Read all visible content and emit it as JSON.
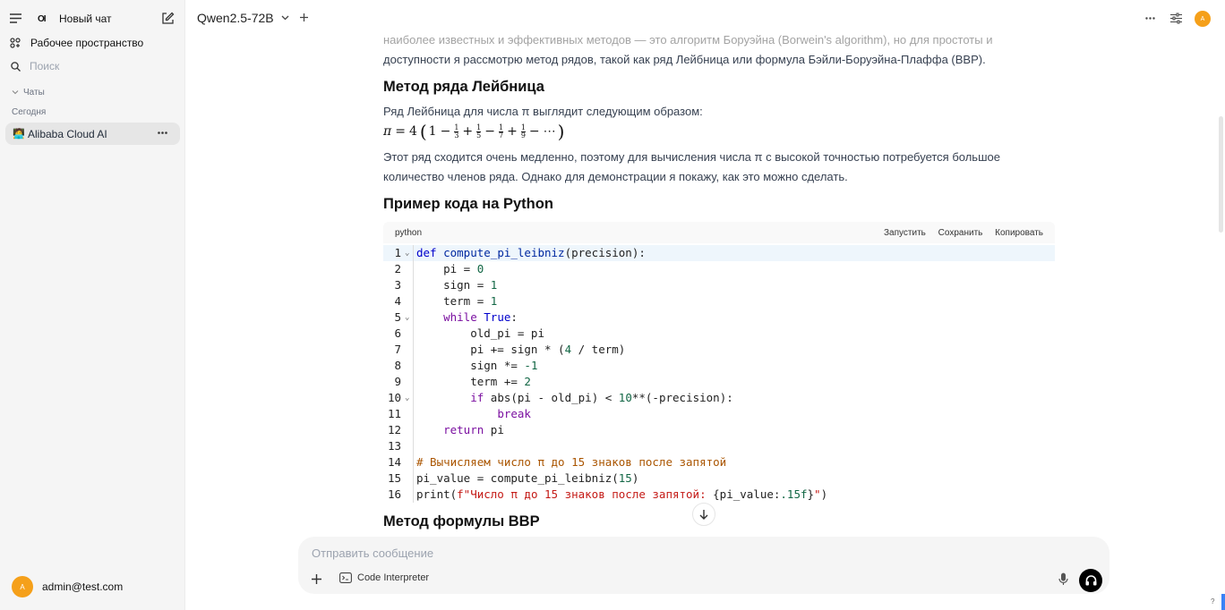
{
  "sidebar": {
    "new_chat": "Новый чат",
    "workspace": "Рабочее пространство",
    "search_placeholder": "Поиск",
    "chats_section": "Чаты",
    "today": "Сегодня",
    "chat_item": "Alibaba Cloud AI",
    "chat_item_emoji": "🧑‍💻",
    "user_email": "admin@test.com",
    "user_initial": "A",
    "logo": "OI"
  },
  "header": {
    "model": "Qwen2.5-72B",
    "avatar": "A"
  },
  "content": {
    "intro_faded": "наиболее известных и эффективных методов — это алгоритм Боруэйна (Borwein's algorithm), но для простоты и",
    "intro": "доступности я рассмотрю метод рядов, такой как ряд Лейбница или формула Бэйли-Боруэйна-Плаффа (BBP).",
    "h_leibniz": "Метод ряда Лейбница",
    "leibniz_text": "Ряд Лейбница для числа π выглядит следующим образом:",
    "formula": "π = 4 (1 − 1/3 + 1/5 − 1/7 + 1/9 − ⋯)",
    "slow_text_1": "Этот ряд сходится очень медленно, поэтому для вычисления числа π с высокой точностью потребуется большое",
    "slow_text_2": "количество членов ряда. Однако для демонстрации я покажу, как это можно сделать.",
    "h_python": "Пример кода на Python",
    "h_bbp": "Метод формулы BBP"
  },
  "code": {
    "language": "python",
    "run": "Запустить",
    "save": "Сохранить",
    "copy": "Копировать",
    "line_numbers": [
      "1",
      "2",
      "3",
      "4",
      "5",
      "6",
      "7",
      "8",
      "9",
      "10",
      "11",
      "12",
      "13",
      "14",
      "15",
      "16"
    ]
  },
  "composer": {
    "placeholder": "Отправить сообщение",
    "code_interpreter": "Code Interpreter"
  },
  "help": "?"
}
